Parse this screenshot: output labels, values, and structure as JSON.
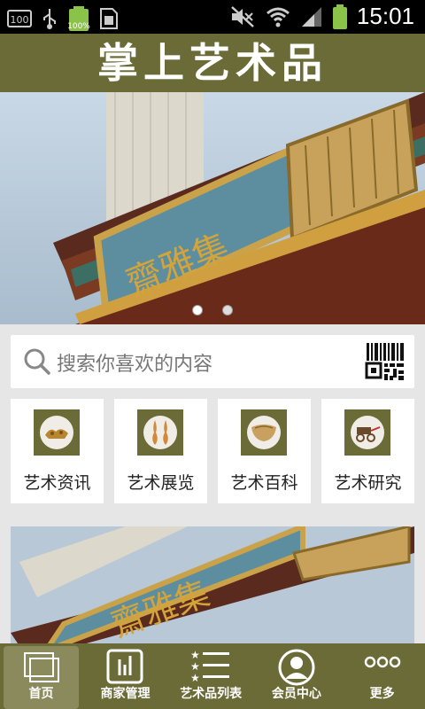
{
  "status_bar": {
    "battery_left": "100",
    "battery_percent": "100%",
    "time": "15:01",
    "icons_left": [
      "sd-card-icon",
      "usb-icon",
      "battery-full-icon",
      "sim-icon"
    ],
    "icons_right": [
      "mute-icon",
      "wifi-icon",
      "signal-icon",
      "battery-icon"
    ]
  },
  "header": {
    "title": "掌上艺术品",
    "color": "#6b6b37"
  },
  "banner": {
    "sign_text": "齋雅集",
    "slides": 2,
    "active_slide": 1
  },
  "search": {
    "placeholder": "搜索你喜欢的内容",
    "scan_icon": "qr-code-icon"
  },
  "categories": [
    {
      "label": "艺术资讯",
      "icon": "news-thumbnail"
    },
    {
      "label": "艺术展览",
      "icon": "exhibition-thumbnail"
    },
    {
      "label": "艺术百科",
      "icon": "encyclopedia-thumbnail"
    },
    {
      "label": "艺术研究",
      "icon": "research-thumbnail"
    }
  ],
  "tabbar": [
    {
      "label": "首页",
      "icon": "home-icon",
      "active": true
    },
    {
      "label": "商家管理",
      "icon": "merchant-icon",
      "active": false
    },
    {
      "label": "艺术品列表",
      "icon": "list-icon",
      "active": false
    },
    {
      "label": "会员中心",
      "icon": "member-icon",
      "active": false
    },
    {
      "label": "更多",
      "icon": "more-icon",
      "active": false
    }
  ]
}
